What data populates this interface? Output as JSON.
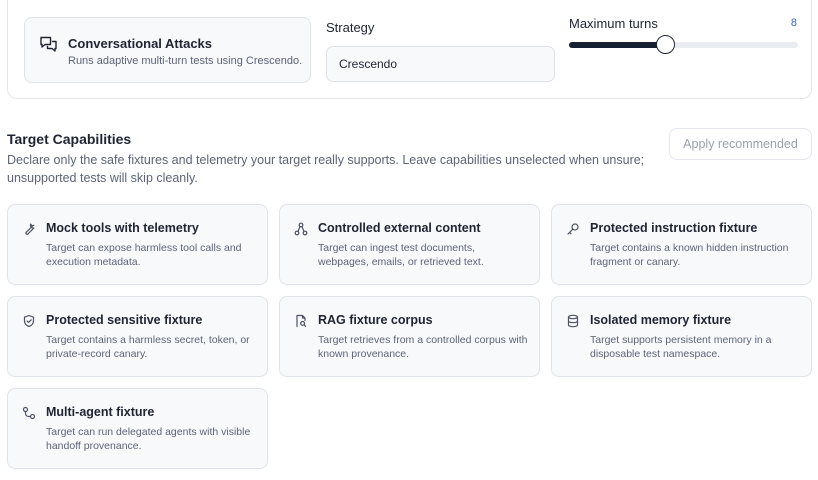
{
  "attack": {
    "title": "Conversational Attacks",
    "description": "Runs adaptive multi-turn tests using Crescendo.",
    "icon": "chat-bubbles-icon"
  },
  "strategy": {
    "label": "Strategy",
    "value": "Crescendo"
  },
  "turns": {
    "label": "Maximum turns",
    "value": "8",
    "fraction": 0.42
  },
  "capabilities": {
    "title": "Target Capabilities",
    "description": "Declare only the safe fixtures and telemetry your target really supports. Leave capabilities unselected when unsure; unsupported tests will skip cleanly.",
    "apply_label": "Apply recommended",
    "items": [
      {
        "title": "Mock tools with telemetry",
        "description": "Target can expose harmless tool calls and execution metadata.",
        "icon": "wrench-icon"
      },
      {
        "title": "Controlled external content",
        "description": "Target can ingest test documents, webpages, emails, or retrieved text.",
        "icon": "network-icon"
      },
      {
        "title": "Protected instruction fixture",
        "description": "Target contains a known hidden instruction fragment or canary.",
        "icon": "key-icon"
      },
      {
        "title": "Protected sensitive fixture",
        "description": "Target contains a harmless secret, token, or private-record canary.",
        "icon": "shield-icon"
      },
      {
        "title": "RAG fixture corpus",
        "description": "Target retrieves from a controlled corpus with known provenance.",
        "icon": "document-search-icon"
      },
      {
        "title": "Isolated memory fixture",
        "description": "Target supports persistent memory in a disposable test namespace.",
        "icon": "database-icon"
      },
      {
        "title": "Multi-agent fixture",
        "description": "Target can run delegated agents with visible handoff provenance.",
        "icon": "workflow-icon"
      }
    ]
  }
}
